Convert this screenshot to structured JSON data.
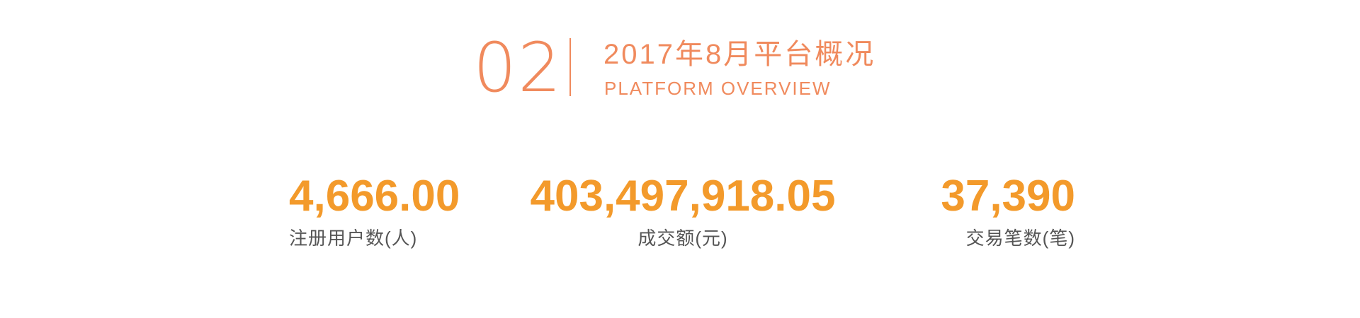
{
  "header": {
    "section_number": "02",
    "title": "2017年8月平台概况",
    "subtitle": "PLATFORM OVERVIEW",
    "accent_color": "#f08a5d"
  },
  "stats": [
    {
      "value": "4,666.00",
      "label": "注册用户数(人)"
    },
    {
      "value": "403,497,918.05",
      "label": "成交额(元)"
    },
    {
      "value": "37,390",
      "label": "交易笔数(笔)"
    }
  ],
  "value_color": "#f39a2b",
  "label_color": "#555555"
}
